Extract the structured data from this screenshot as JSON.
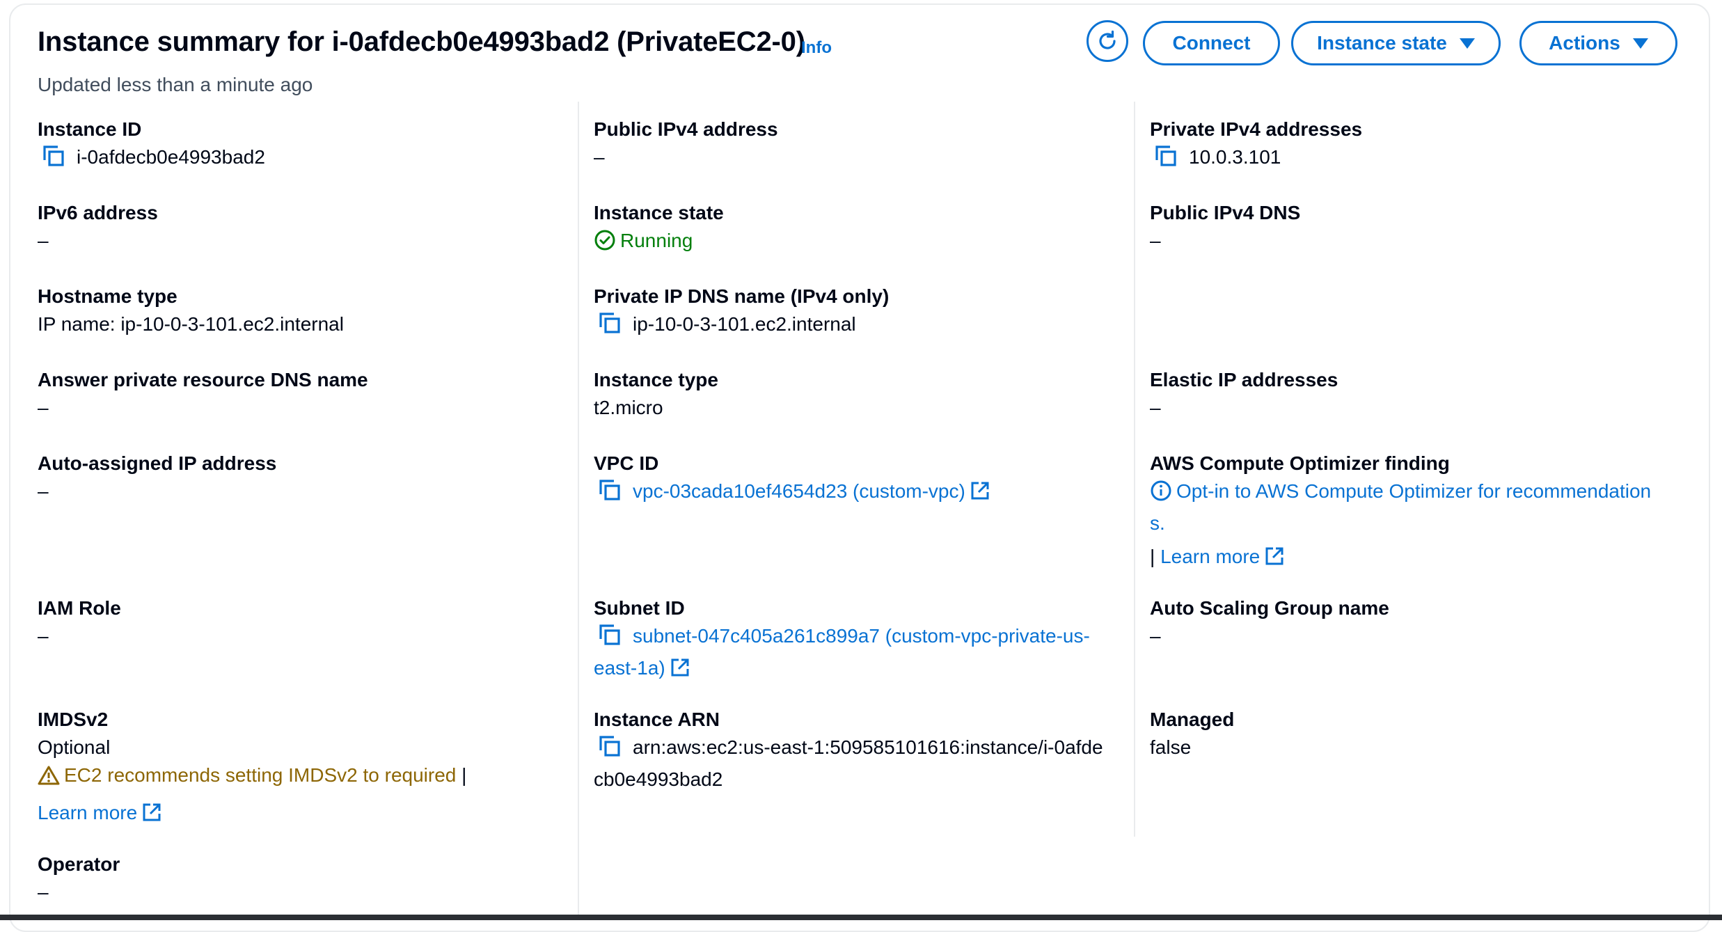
{
  "header": {
    "title": "Instance summary for i-0afdecb0e4993bad2 (PrivateEC2-0)",
    "info": "Info",
    "updated": "Updated less than a minute ago",
    "buttons": {
      "connect": "Connect",
      "instance_state": "Instance state",
      "actions": "Actions"
    }
  },
  "fields": {
    "instance_id": {
      "label": "Instance ID",
      "value": "i-0afdecb0e4993bad2"
    },
    "public_ipv4": {
      "label": "Public IPv4 address",
      "value": "–"
    },
    "private_ipv4": {
      "label": "Private IPv4 addresses",
      "value": "10.0.3.101"
    },
    "ipv6": {
      "label": "IPv6 address",
      "value": "–"
    },
    "instance_state": {
      "label": "Instance state",
      "value": "Running"
    },
    "public_dns": {
      "label": "Public IPv4 DNS",
      "value": "–"
    },
    "hostname_type": {
      "label": "Hostname type",
      "value": "IP name: ip-10-0-3-101.ec2.internal"
    },
    "private_dns": {
      "label": "Private IP DNS name (IPv4 only)",
      "value": "ip-10-0-3-101.ec2.internal"
    },
    "answer_dns": {
      "label": "Answer private resource DNS name",
      "value": "–"
    },
    "instance_type": {
      "label": "Instance type",
      "value": "t2.micro"
    },
    "elastic_ip": {
      "label": "Elastic IP addresses",
      "value": "–"
    },
    "auto_ip": {
      "label": "Auto-assigned IP address",
      "value": "–"
    },
    "vpc_id": {
      "label": "VPC ID",
      "value": "vpc-03cada10ef4654d23 (custom-vpc)"
    },
    "optimizer": {
      "label": "AWS Compute Optimizer finding",
      "line1": "Opt-in to AWS Compute Optimizer for recommendation",
      "line2": "s.",
      "sep": "|",
      "learn_more": "Learn more"
    },
    "iam_role": {
      "label": "IAM Role",
      "value": "–"
    },
    "subnet_id": {
      "label": "Subnet ID",
      "line1": "subnet-047c405a261c899a7 (custom-vpc-private-us-",
      "line2": "east-1a)"
    },
    "asg_name": {
      "label": "Auto Scaling Group name",
      "value": "–"
    },
    "imdsv2": {
      "label": "IMDSv2",
      "value": "Optional",
      "warning": "EC2 recommends setting IMDSv2 to required",
      "sep": "|",
      "learn_more": "Learn more"
    },
    "instance_arn": {
      "label": "Instance ARN",
      "line1": "arn:aws:ec2:us-east-1:509585101616:instance/i-0afde",
      "line2": "cb0e4993bad2"
    },
    "managed": {
      "label": "Managed",
      "value": "false"
    },
    "operator": {
      "label": "Operator",
      "value": "–"
    }
  },
  "colors": {
    "link": "#0972d3",
    "success": "#037f0c",
    "warning": "#8d6605",
    "text": "#000716"
  }
}
